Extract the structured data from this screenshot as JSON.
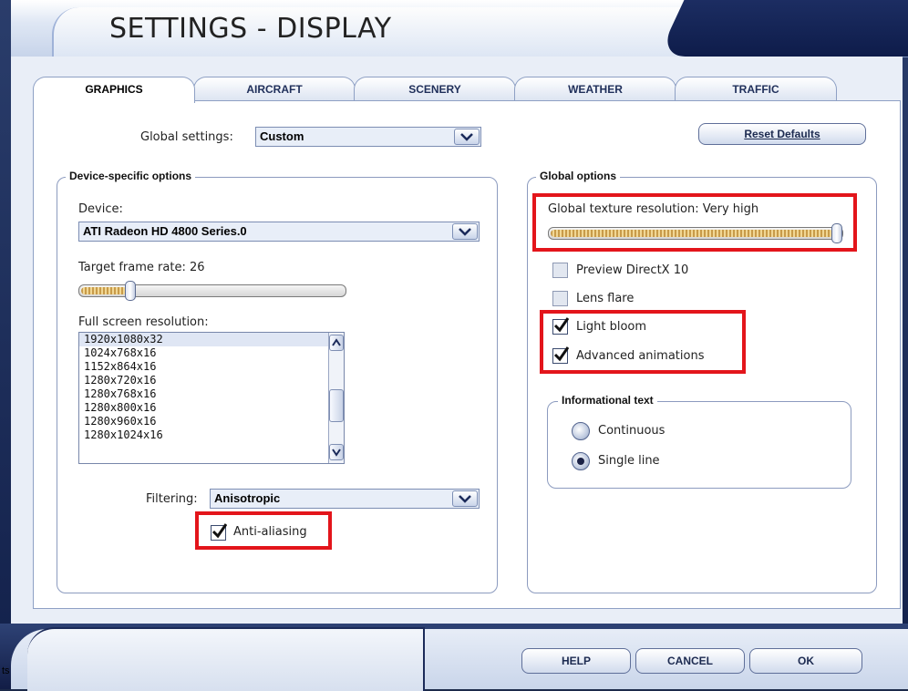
{
  "window": {
    "title": "SETTINGS - DISPLAY"
  },
  "tabs": [
    {
      "label": "GRAPHICS",
      "active": true
    },
    {
      "label": "AIRCRAFT",
      "active": false
    },
    {
      "label": "SCENERY",
      "active": false
    },
    {
      "label": "WEATHER",
      "active": false
    },
    {
      "label": "TRAFFIC",
      "active": false
    }
  ],
  "global_settings": {
    "label": "Global settings:",
    "value": "Custom"
  },
  "reset_defaults": "Reset Defaults",
  "device_options": {
    "title": "Device-specific options",
    "device_label": "Device:",
    "device_value": "ATI Radeon HD 4800 Series.0",
    "frame_rate_label": "Target frame rate: 26",
    "frame_rate_fraction": 0.18,
    "resolution_label": "Full screen resolution:",
    "resolutions": [
      "1920x1080x32",
      "1024x768x16",
      "1152x864x16",
      "1280x720x16",
      "1280x768x16",
      "1280x800x16",
      "1280x960x16",
      "1280x1024x16"
    ],
    "filtering_label": "Filtering:",
    "filtering_value": "Anisotropic",
    "anti_aliasing_label": "Anti-aliasing",
    "anti_aliasing_checked": true
  },
  "global_options": {
    "title": "Global options",
    "texture_label": "Global texture resolution: Very high",
    "texture_fraction": 1.0,
    "checkboxes": [
      {
        "label": "Preview DirectX 10",
        "checked": false
      },
      {
        "label": "Lens flare",
        "checked": false
      },
      {
        "label": "Light bloom",
        "checked": true
      },
      {
        "label": "Advanced animations",
        "checked": true
      }
    ],
    "info_text": {
      "title": "Informational text",
      "options": [
        {
          "label": "Continuous",
          "selected": false
        },
        {
          "label": "Single line",
          "selected": true
        }
      ]
    }
  },
  "footer": {
    "help": "HELP",
    "cancel": "CANCEL",
    "ok": "OK",
    "corner_text": "ts"
  },
  "colors": {
    "highlight": "#e3151b",
    "accent": "#1c2d62"
  }
}
